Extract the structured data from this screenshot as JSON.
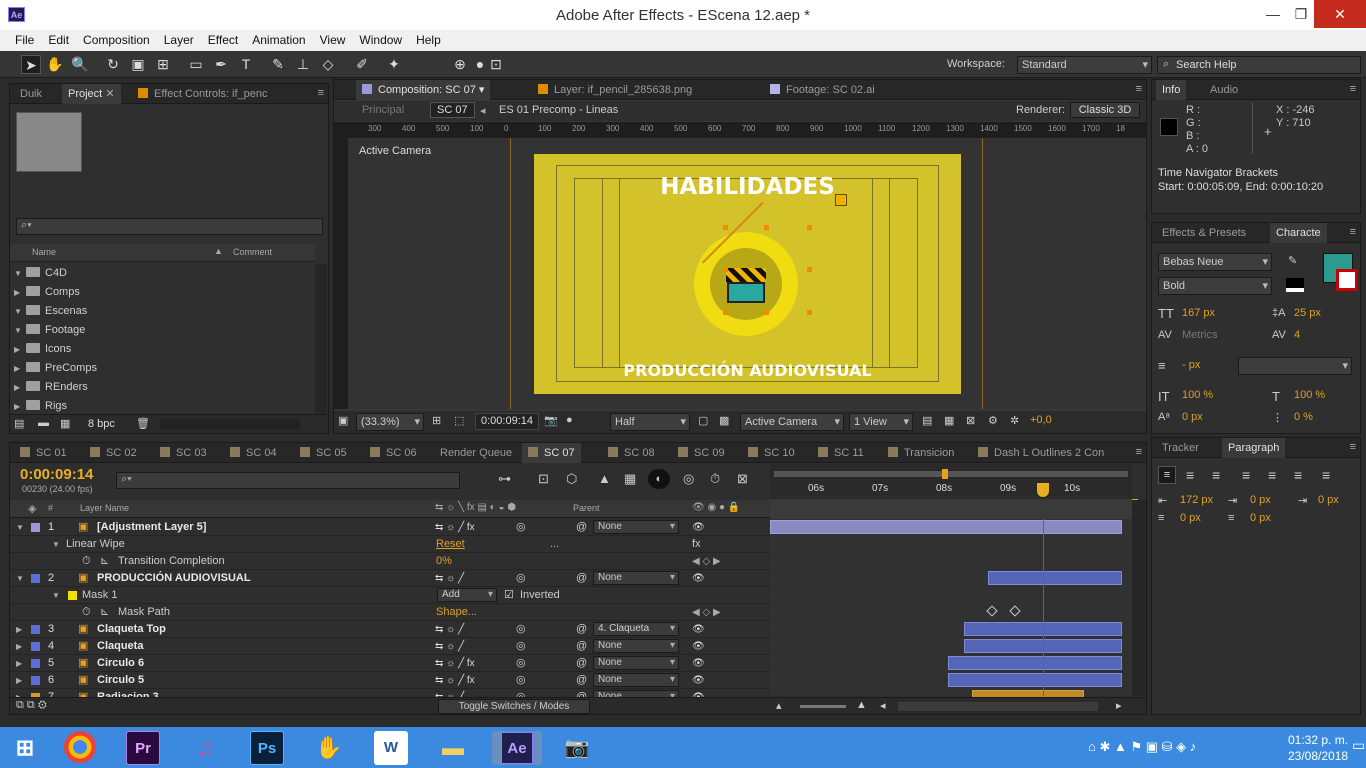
{
  "window": {
    "title": "Adobe After Effects - EScena 12.aep *",
    "logo": "Ae",
    "minimize": "—",
    "restore": "❐",
    "close": "✕"
  },
  "menu": [
    "File",
    "Edit",
    "Composition",
    "Layer",
    "Effect",
    "Animation",
    "View",
    "Window",
    "Help"
  ],
  "toolbar": {
    "workspace_label": "Workspace:",
    "workspace_value": "Standard",
    "search_placeholder": "Search Help"
  },
  "project": {
    "tabs": [
      "Duik",
      "Project",
      "Effect Controls: if_penc"
    ],
    "col_name": "Name",
    "col_comment": "Comment",
    "bpc": "8 bpc",
    "items": [
      {
        "name": "C4D",
        "open": true
      },
      {
        "name": "Comps",
        "open": false
      },
      {
        "name": "Escenas",
        "open": true
      },
      {
        "name": "Footage",
        "open": true
      },
      {
        "name": "Icons",
        "open": false
      },
      {
        "name": "PreComps",
        "open": false
      },
      {
        "name": "REnders",
        "open": false
      },
      {
        "name": "Rigs",
        "open": false
      }
    ]
  },
  "viewer": {
    "tabs": [
      "Composition: SC 07",
      "Layer: if_pencil_285638.png",
      "Footage: SC 02.ai"
    ],
    "breadcrumb": [
      "Principal",
      "SC 07",
      "ES 01 Precomp - Lineas"
    ],
    "renderer_label": "Renderer:",
    "renderer_value": "Classic 3D",
    "active_camera_label": "Active Camera",
    "ruler_ticks": [
      "300",
      "400",
      "500",
      "100",
      "0",
      "100",
      "200",
      "300",
      "400",
      "500",
      "600",
      "700",
      "800",
      "900",
      "1000",
      "1100",
      "1200",
      "1300",
      "1400",
      "1500",
      "1600",
      "1700",
      "18"
    ],
    "comp_title": "HABILIDADES",
    "comp_subtitle": "PRODUCCIÓN AUDIOVISUAL",
    "bottom": {
      "zoom": "(33.3%)",
      "timecode": "0:00:09:14",
      "resolution": "Half",
      "camera": "Active Camera",
      "views": "1 View",
      "exposure": "+0,0"
    }
  },
  "info": {
    "tabs": [
      "Info",
      "Audio"
    ],
    "r": "R :",
    "g": "G :",
    "b": "B :",
    "a": "A : 0",
    "x": "X : -246",
    "y": "Y : 710",
    "brackets_title": "Time Navigator Brackets",
    "brackets_value": "Start: 0:00:05:09, End: 0:00:10:20"
  },
  "character": {
    "tabs": [
      "Effects & Presets",
      "Characte"
    ],
    "font": "Bebas Neue",
    "style": "Bold",
    "size": "167 px",
    "leading": "25 px",
    "kerning": "Metrics",
    "tracking": "4",
    "stroke": "- px",
    "vscale": "100 %",
    "hscale": "100 %",
    "baseline": "0 px",
    "tsume": "0 %",
    "fill_color": "#2a9b8e"
  },
  "paragraph": {
    "tabs": [
      "Tracker",
      "Paragraph"
    ],
    "indent_left": "172 px",
    "indent_first": "0 px",
    "indent_right": "0 px",
    "space_before": "0 px",
    "space_after": "0 px"
  },
  "timeline": {
    "tabs": [
      "SC 01",
      "SC 02",
      "SC 03",
      "SC 04",
      "SC 05",
      "SC 06",
      "Render Queue",
      "SC 07",
      "SC 08",
      "SC 09",
      "SC 10",
      "SC 11",
      "Transicion",
      "Dash L Outlines 2 Con"
    ],
    "timecode": "0:00:09:14",
    "frames": "00230 (24.00 fps)",
    "col_hash": "#",
    "col_layer_name": "Layer Name",
    "col_parent": "Parent",
    "time_labels": [
      "06s",
      "07s",
      "08s",
      "09s",
      "10s"
    ],
    "toggle_label": "Toggle Switches / Modes",
    "rows": [
      {
        "kind": "layer",
        "num": "1",
        "name": "[Adjustment Layer 5]",
        "label": "#9a9ad8",
        "parent": "None",
        "fx": true
      },
      {
        "kind": "prop",
        "name": "Linear Wipe",
        "value": "Reset",
        "extra": "..."
      },
      {
        "kind": "subprop",
        "name": "Transition Completion",
        "value": "0%"
      },
      {
        "kind": "layer",
        "num": "2",
        "name": "PRODUCCIÓN AUDIOVISUAL",
        "label": "#5b6fd6",
        "parent": "None",
        "fx": false
      },
      {
        "kind": "mask",
        "name": "Mask 1",
        "value": "Add",
        "inverted": "Inverted"
      },
      {
        "kind": "subprop",
        "name": "Mask Path",
        "value": "Shape..."
      },
      {
        "kind": "layer",
        "num": "3",
        "name": "Claqueta Top",
        "label": "#5b6fd6",
        "parent": "4. Claqueta",
        "fx": false
      },
      {
        "kind": "layer",
        "num": "4",
        "name": "Claqueta",
        "label": "#5b6fd6",
        "parent": "None",
        "fx": false
      },
      {
        "kind": "layer",
        "num": "5",
        "name": "Circulo 6",
        "label": "#5b6fd6",
        "parent": "None",
        "fx": true
      },
      {
        "kind": "layer",
        "num": "6",
        "name": "Circulo 5",
        "label": "#5b6fd6",
        "parent": "None",
        "fx": true
      },
      {
        "kind": "layer",
        "num": "7",
        "name": "Radiacion 3",
        "label": "#d89a2a",
        "parent": "None",
        "fx": false
      }
    ]
  },
  "taskbar": {
    "apps": [
      "Pr",
      "Ps",
      "Ae"
    ],
    "time": "01:32 p. m.",
    "date": "23/08/2018"
  }
}
